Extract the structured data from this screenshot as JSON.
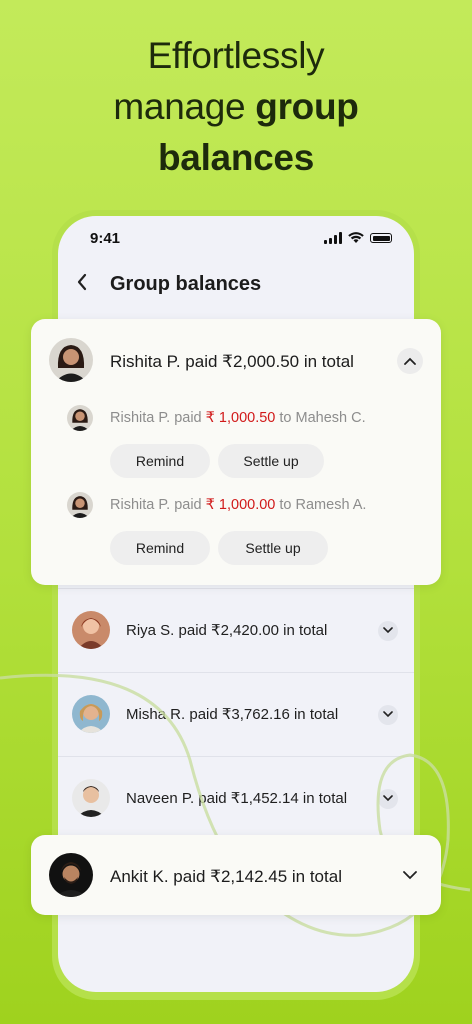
{
  "headline": {
    "line1": "Effortlessly",
    "line2_plain": "manage ",
    "line2_bold": "group",
    "line3_bold": "balances"
  },
  "status_bar": {
    "time": "9:41"
  },
  "nav": {
    "back_icon": "chevron-left-icon",
    "title": "Group balances"
  },
  "expanded_card": {
    "summary": "Rishita P. paid ₹2,000.50 in total",
    "debts": [
      {
        "prefix": "Rishita P. paid ",
        "amount": "₹ 1,000.50",
        "suffix": " to Mahesh C.",
        "remind": "Remind",
        "settle": "Settle up"
      },
      {
        "prefix": "Rishita P. paid ",
        "amount": "₹ 1,000.00",
        "suffix": " to Ramesh A.",
        "remind": "Remind",
        "settle": "Settle up"
      }
    ]
  },
  "rows": [
    {
      "summary": "Riya S. paid ₹2,420.00 in total"
    },
    {
      "summary": "Misha R. paid ₹3,762.16 in total"
    },
    {
      "summary": "Naveen P. paid ₹1,452.14 in total"
    }
  ],
  "highlight_card": {
    "summary": "Ankit K. paid ₹2,142.45 in total"
  },
  "colors": {
    "background": "#b2e03c",
    "amount_red": "#d11a1a",
    "screen": "#f1f2f8"
  }
}
